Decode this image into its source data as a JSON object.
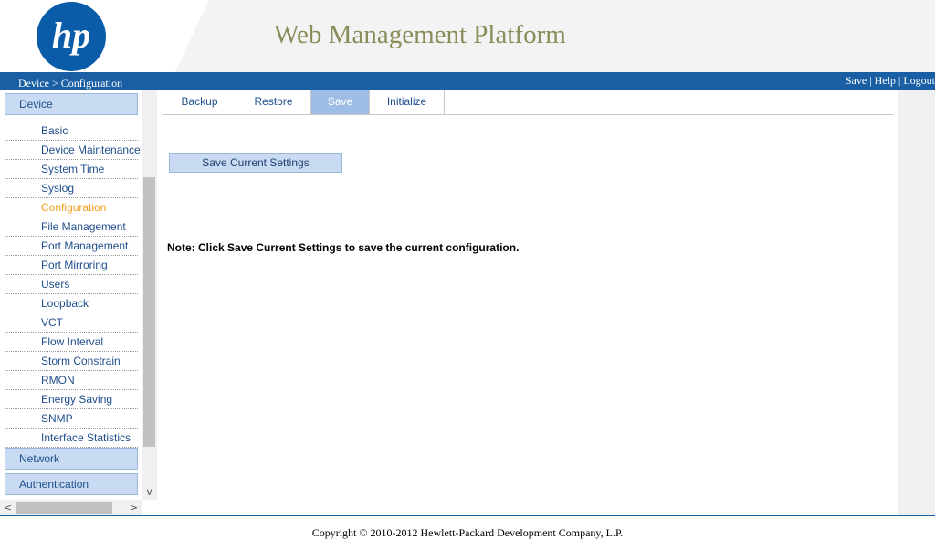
{
  "header": {
    "logo_text": "hp",
    "title": "Web Management Platform"
  },
  "topbar": {
    "breadcrumb": "Device > Configuration",
    "links": {
      "save": "Save",
      "help": "Help",
      "logout": "Logout",
      "sep": "|"
    }
  },
  "sidebar": {
    "device_label": "Device",
    "items": [
      {
        "label": "Basic"
      },
      {
        "label": "Device Maintenance"
      },
      {
        "label": "System Time"
      },
      {
        "label": "Syslog"
      },
      {
        "label": "Configuration"
      },
      {
        "label": "File Management"
      },
      {
        "label": "Port Management"
      },
      {
        "label": "Port Mirroring"
      },
      {
        "label": "Users"
      },
      {
        "label": "Loopback"
      },
      {
        "label": "VCT"
      },
      {
        "label": "Flow Interval"
      },
      {
        "label": "Storm Constrain"
      },
      {
        "label": "RMON"
      },
      {
        "label": "Energy Saving"
      },
      {
        "label": "SNMP"
      },
      {
        "label": "Interface Statistics"
      }
    ],
    "active_item": "Configuration",
    "network_label": "Network",
    "auth_label": "Authentication"
  },
  "scroll": {
    "down_arrow": "∨",
    "left_arrow": "<",
    "right_arrow": ">"
  },
  "tabs": [
    {
      "label": "Backup"
    },
    {
      "label": "Restore"
    },
    {
      "label": "Save"
    },
    {
      "label": "Initialize"
    }
  ],
  "active_tab": "Save",
  "main": {
    "save_button": "Save Current Settings",
    "note": "Note: Click Save Current Settings to save the current configuration."
  },
  "footer": {
    "copyright": "Copyright © 2010-2012 Hewlett-Packard Development Company, L.P."
  },
  "colors": {
    "brand_blue": "#1a5fa3",
    "active_orange": "#f0a020",
    "nav_blue": "#1f4e8c"
  }
}
